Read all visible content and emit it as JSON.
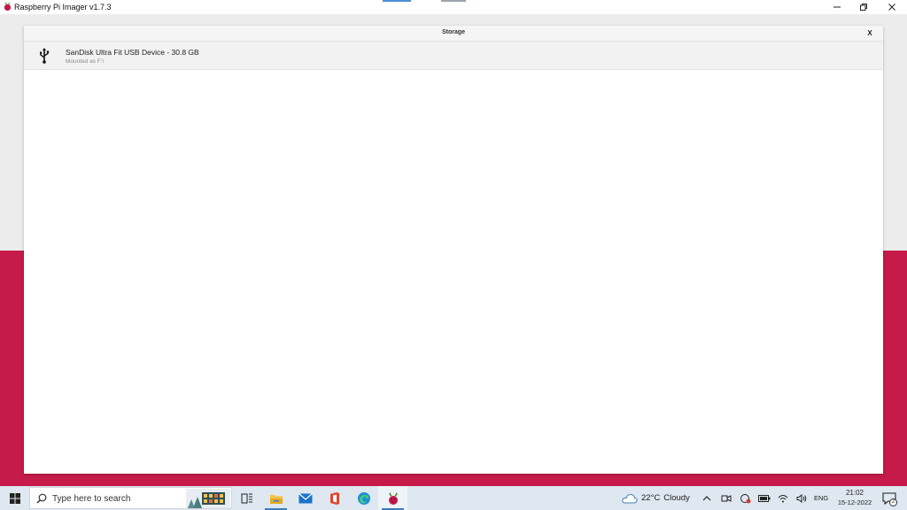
{
  "window": {
    "title": "Raspberry Pi Imager v1.7.3",
    "minimize_icon": "minimize-icon",
    "maximize_icon": "restore-icon",
    "close_icon": "close-icon"
  },
  "colors": {
    "accent": "#c51a4a",
    "backdrop": "#ececec",
    "taskbar": "#dfe7f0",
    "active_underline": "#3d7ac0"
  },
  "dialog": {
    "title": "Storage",
    "close_label": "X",
    "devices": [
      {
        "name": "SanDisk Ultra Fit USB Device - 30.8 GB",
        "subtitle": "Mounted as F:\\",
        "icon": "usb-icon"
      }
    ]
  },
  "taskbar": {
    "search_placeholder": "Type here to search",
    "pinned": [
      {
        "name": "task-view",
        "icon": "task-view-icon"
      },
      {
        "name": "file-explorer",
        "icon": "folder-icon"
      },
      {
        "name": "mail",
        "icon": "mail-icon"
      },
      {
        "name": "office",
        "icon": "office-icon"
      },
      {
        "name": "edge",
        "icon": "edge-icon"
      },
      {
        "name": "raspberry-pi-imager",
        "icon": "raspberry-icon",
        "active": true
      }
    ],
    "weather": {
      "temp": "22°C",
      "condition": "Cloudy"
    },
    "language": "ENG",
    "time": "21:02",
    "date": "15-12-2022",
    "notification_count": "2"
  }
}
